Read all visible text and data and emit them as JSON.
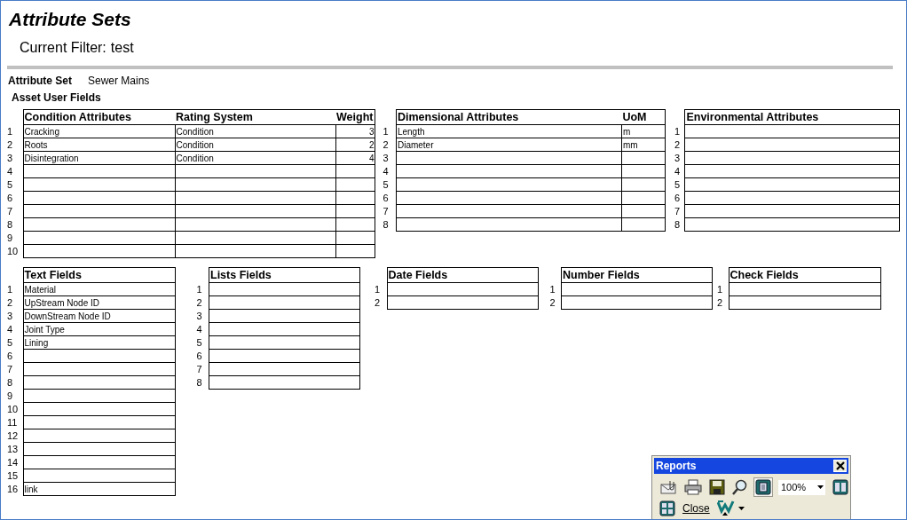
{
  "title": "Attribute Sets",
  "filter": {
    "label": "Current Filter:",
    "value": "test"
  },
  "attribute_set": {
    "label": "Attribute Set",
    "value": "Sewer Mains"
  },
  "section_title": "Asset User Fields",
  "table_groups": [
    {
      "tables": [
        {
          "columns": [
            {
              "label": "Condition Attributes",
              "kind": "text"
            },
            {
              "label": "Rating System",
              "kind": "text"
            },
            {
              "label": "Weight",
              "kind": "number"
            }
          ],
          "rows": [
            {
              "number": "1",
              "cells": [
                "Cracking",
                "Condition",
                "3"
              ]
            },
            {
              "number": "2",
              "cells": [
                "Roots",
                "Condition",
                "2"
              ]
            },
            {
              "number": "3",
              "cells": [
                "Disintegration",
                "Condition",
                "4"
              ]
            },
            {
              "number": "4"
            },
            {
              "number": "5"
            },
            {
              "number": "6"
            },
            {
              "number": "7"
            },
            {
              "number": "8"
            },
            {
              "number": "9"
            },
            {
              "number": "10"
            }
          ]
        },
        {
          "columns": [
            {
              "label": "Dimensional Attributes",
              "kind": "text"
            },
            {
              "label": "UoM",
              "kind": "text"
            }
          ],
          "rows": [
            {
              "number": "1",
              "cells": [
                "Length",
                "m"
              ]
            },
            {
              "number": "2",
              "cells": [
                "Diameter",
                "mm"
              ]
            },
            {
              "number": "3"
            },
            {
              "number": "4"
            },
            {
              "number": "5"
            },
            {
              "number": "6"
            },
            {
              "number": "7"
            },
            {
              "number": "8"
            }
          ]
        },
        {
          "columns": [
            {
              "label": "Environmental Attributes",
              "kind": "text"
            }
          ],
          "rows": [
            {
              "number": "1"
            },
            {
              "number": "2"
            },
            {
              "number": "3"
            },
            {
              "number": "4"
            },
            {
              "number": "5"
            },
            {
              "number": "6"
            },
            {
              "number": "7"
            },
            {
              "number": "8"
            }
          ]
        }
      ]
    },
    {
      "tables": [
        {
          "columns": [
            {
              "label": "Text Fields",
              "kind": "text"
            }
          ],
          "rows": [
            {
              "number": "1",
              "cells": [
                "Material"
              ]
            },
            {
              "number": "2",
              "cells": [
                "UpStream Node ID"
              ]
            },
            {
              "number": "3",
              "cells": [
                "DownStream Node ID"
              ]
            },
            {
              "number": "4",
              "cells": [
                "Joint Type"
              ]
            },
            {
              "number": "5",
              "cells": [
                "Lining"
              ]
            },
            {
              "number": "6"
            },
            {
              "number": "7"
            },
            {
              "number": "8"
            },
            {
              "number": "9"
            },
            {
              "number": "10"
            },
            {
              "number": "11"
            },
            {
              "number": "12"
            },
            {
              "number": "13"
            },
            {
              "number": "14"
            },
            {
              "number": "15"
            },
            {
              "number": "16",
              "cells": [
                "link"
              ]
            }
          ]
        },
        {
          "columns": [
            {
              "label": "Lists Fields",
              "kind": "text"
            }
          ],
          "rows": [
            {
              "number": "1"
            },
            {
              "number": "2"
            },
            {
              "number": "3"
            },
            {
              "number": "4"
            },
            {
              "number": "5"
            },
            {
              "number": "6"
            },
            {
              "number": "7"
            },
            {
              "number": "8"
            }
          ]
        },
        {
          "columns": [
            {
              "label": "Date Fields",
              "kind": "text"
            }
          ],
          "rows": [
            {
              "number": "1"
            },
            {
              "number": "2"
            }
          ]
        },
        {
          "columns": [
            {
              "label": "Number Fields",
              "kind": "text"
            }
          ],
          "rows": [
            {
              "number": "1"
            },
            {
              "number": "2"
            }
          ]
        },
        {
          "columns": [
            {
              "label": "Check Fields",
              "kind": "text"
            }
          ],
          "rows": [
            {
              "number": "1"
            },
            {
              "number": "2"
            }
          ]
        }
      ]
    }
  ],
  "toolbar": {
    "title": "Reports",
    "rows": [
      [
        {
          "kind": "mail",
          "selected": false
        },
        {
          "kind": "print",
          "selected": false
        },
        {
          "kind": "save",
          "selected": false
        },
        {
          "kind": "zoom",
          "selected": false
        },
        {
          "kind": "one-page",
          "selected": true
        },
        {
          "kind": "zoom-combo",
          "value": "100%"
        },
        {
          "kind": "two-pages",
          "selected": false
        }
      ],
      [
        {
          "kind": "multi-page",
          "selected": false
        },
        {
          "kind": "text",
          "label": "Close"
        },
        {
          "kind": "word-export"
        }
      ]
    ]
  }
}
